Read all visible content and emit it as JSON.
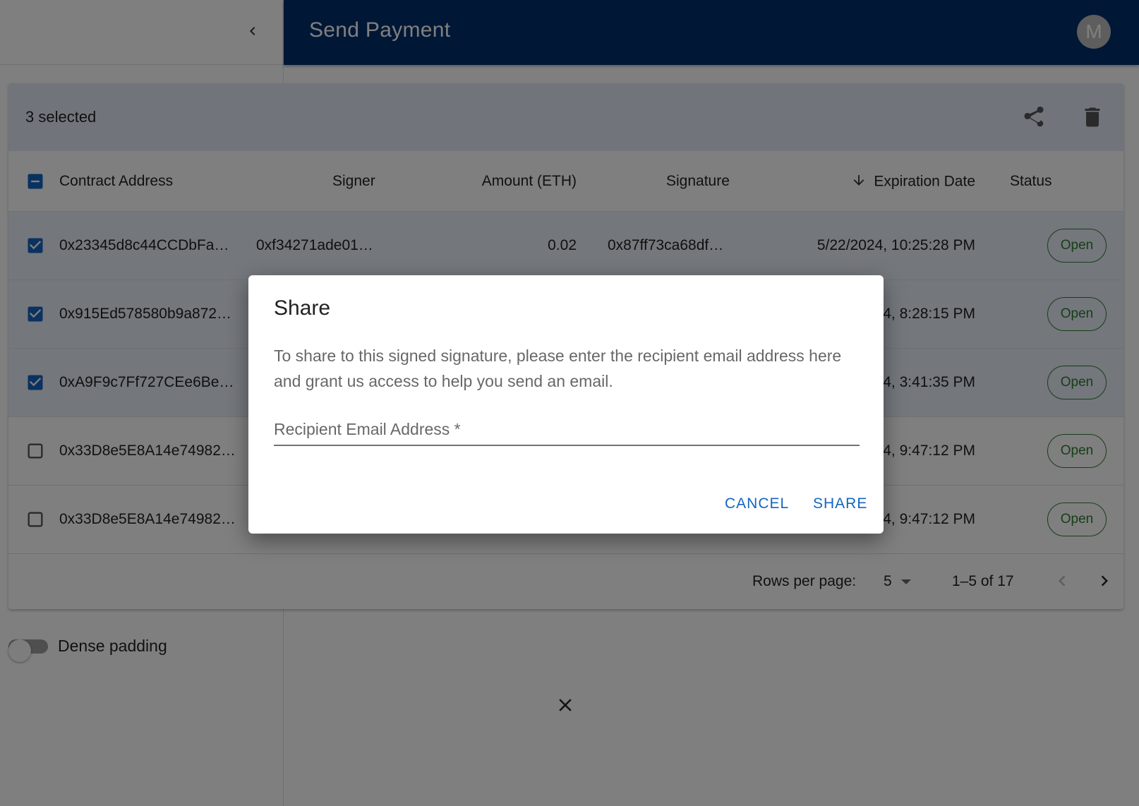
{
  "app": {
    "title": "Send Payment",
    "avatar_initial": "M"
  },
  "toolbar": {
    "selected_label": "3 selected"
  },
  "table": {
    "headers": {
      "contract_address": "Contract Address",
      "signer": "Signer",
      "amount": "Amount (ETH)",
      "signature": "Signature",
      "expiration": "Expiration Date",
      "status": "Status"
    },
    "rows": [
      {
        "checked": true,
        "address": "0x23345d8c44CCDbFa…",
        "signer": "0xf34271ade01…",
        "amount": "0.02",
        "signature": "0x87ff73ca68df…",
        "expiration": "5/22/2024, 10:25:28 PM",
        "status": "Open"
      },
      {
        "checked": true,
        "address": "0x915Ed578580b9a872…",
        "signer": "",
        "amount": "",
        "signature": "",
        "expiration": "4, 8:28:15 PM",
        "status": "Open"
      },
      {
        "checked": true,
        "address": "0xA9F9c7Ff727CEe6Be…",
        "signer": "",
        "amount": "",
        "signature": "",
        "expiration": "4, 3:41:35 PM",
        "status": "Open"
      },
      {
        "checked": false,
        "address": "0x33D8e5E8A14e74982…",
        "signer": "",
        "amount": "",
        "signature": "",
        "expiration": "4, 9:47:12 PM",
        "status": "Open"
      },
      {
        "checked": false,
        "address": "0x33D8e5E8A14e74982…",
        "signer": "",
        "amount": "",
        "signature": "",
        "expiration": "4, 9:47:12 PM",
        "status": "Open"
      }
    ]
  },
  "pagination": {
    "rows_per_page_label": "Rows per page:",
    "rows_per_page_value": "5",
    "range": "1–5 of 17"
  },
  "dense_padding": {
    "label": "Dense padding",
    "enabled": false
  },
  "dialog": {
    "title": "Share",
    "text": "To share to this signed signature, please enter the recipient email address here and grant us access to help you send an email.",
    "email_placeholder": "Recipient Email Address *",
    "cancel_label": "CANCEL",
    "share_label": "SHARE"
  },
  "colors": {
    "appbar": "#002f6c",
    "selected_row": "#e8eef8",
    "checkbox": "#1565c0",
    "status_chip": "#2e7d32",
    "dialog_button": "#1565c0"
  }
}
